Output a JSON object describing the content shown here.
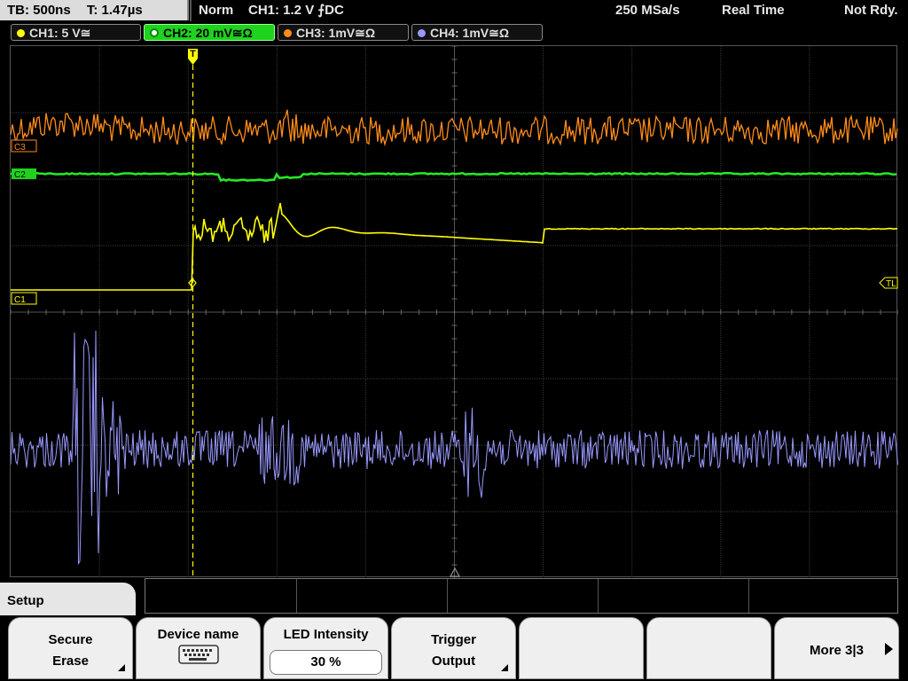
{
  "topbar": {
    "timebase": "TB: 500ns",
    "trigger_time": "T: 1.47µs",
    "acq_mode": "Norm",
    "trigger_info": "CH1: 1.2 V ⨍DC",
    "sample_rate": "250 MSa/s",
    "mode": "Real Time",
    "status": "Not Rdy."
  },
  "channels": [
    {
      "id": "ch1",
      "label": "CH1: 5 V≅",
      "color": "#ffff00",
      "active": false
    },
    {
      "id": "ch2",
      "label": "CH2: 20 mV≅Ω",
      "color": "#22ee22",
      "active": true
    },
    {
      "id": "ch3",
      "label": "CH3: 1mV≅Ω",
      "color": "#ff8c1a",
      "active": false
    },
    {
      "id": "ch4",
      "label": "CH4: 1mV≅Ω",
      "color": "#9999ff",
      "active": false
    }
  ],
  "markers": {
    "ch3": "C3",
    "ch2": "C2",
    "ch1": "C1",
    "trigger_level": "TL",
    "trigger_pos": "T"
  },
  "setup_tab": "Setup",
  "softkeys": {
    "secure_erase": {
      "line1": "Secure",
      "line2": "Erase"
    },
    "device_name": {
      "line1": "Device name"
    },
    "led_intensity": {
      "line1": "LED Intensity",
      "value": "30 %"
    },
    "trigger_output": {
      "line1": "Trigger",
      "line2": "Output"
    },
    "more": {
      "line1": "More 3|3"
    }
  },
  "colors": {
    "ch1": "#ffff00",
    "ch2": "#22ee22",
    "ch3": "#ff8c1a",
    "ch4": "#9999ff",
    "grid": "#3a3a3a"
  }
}
